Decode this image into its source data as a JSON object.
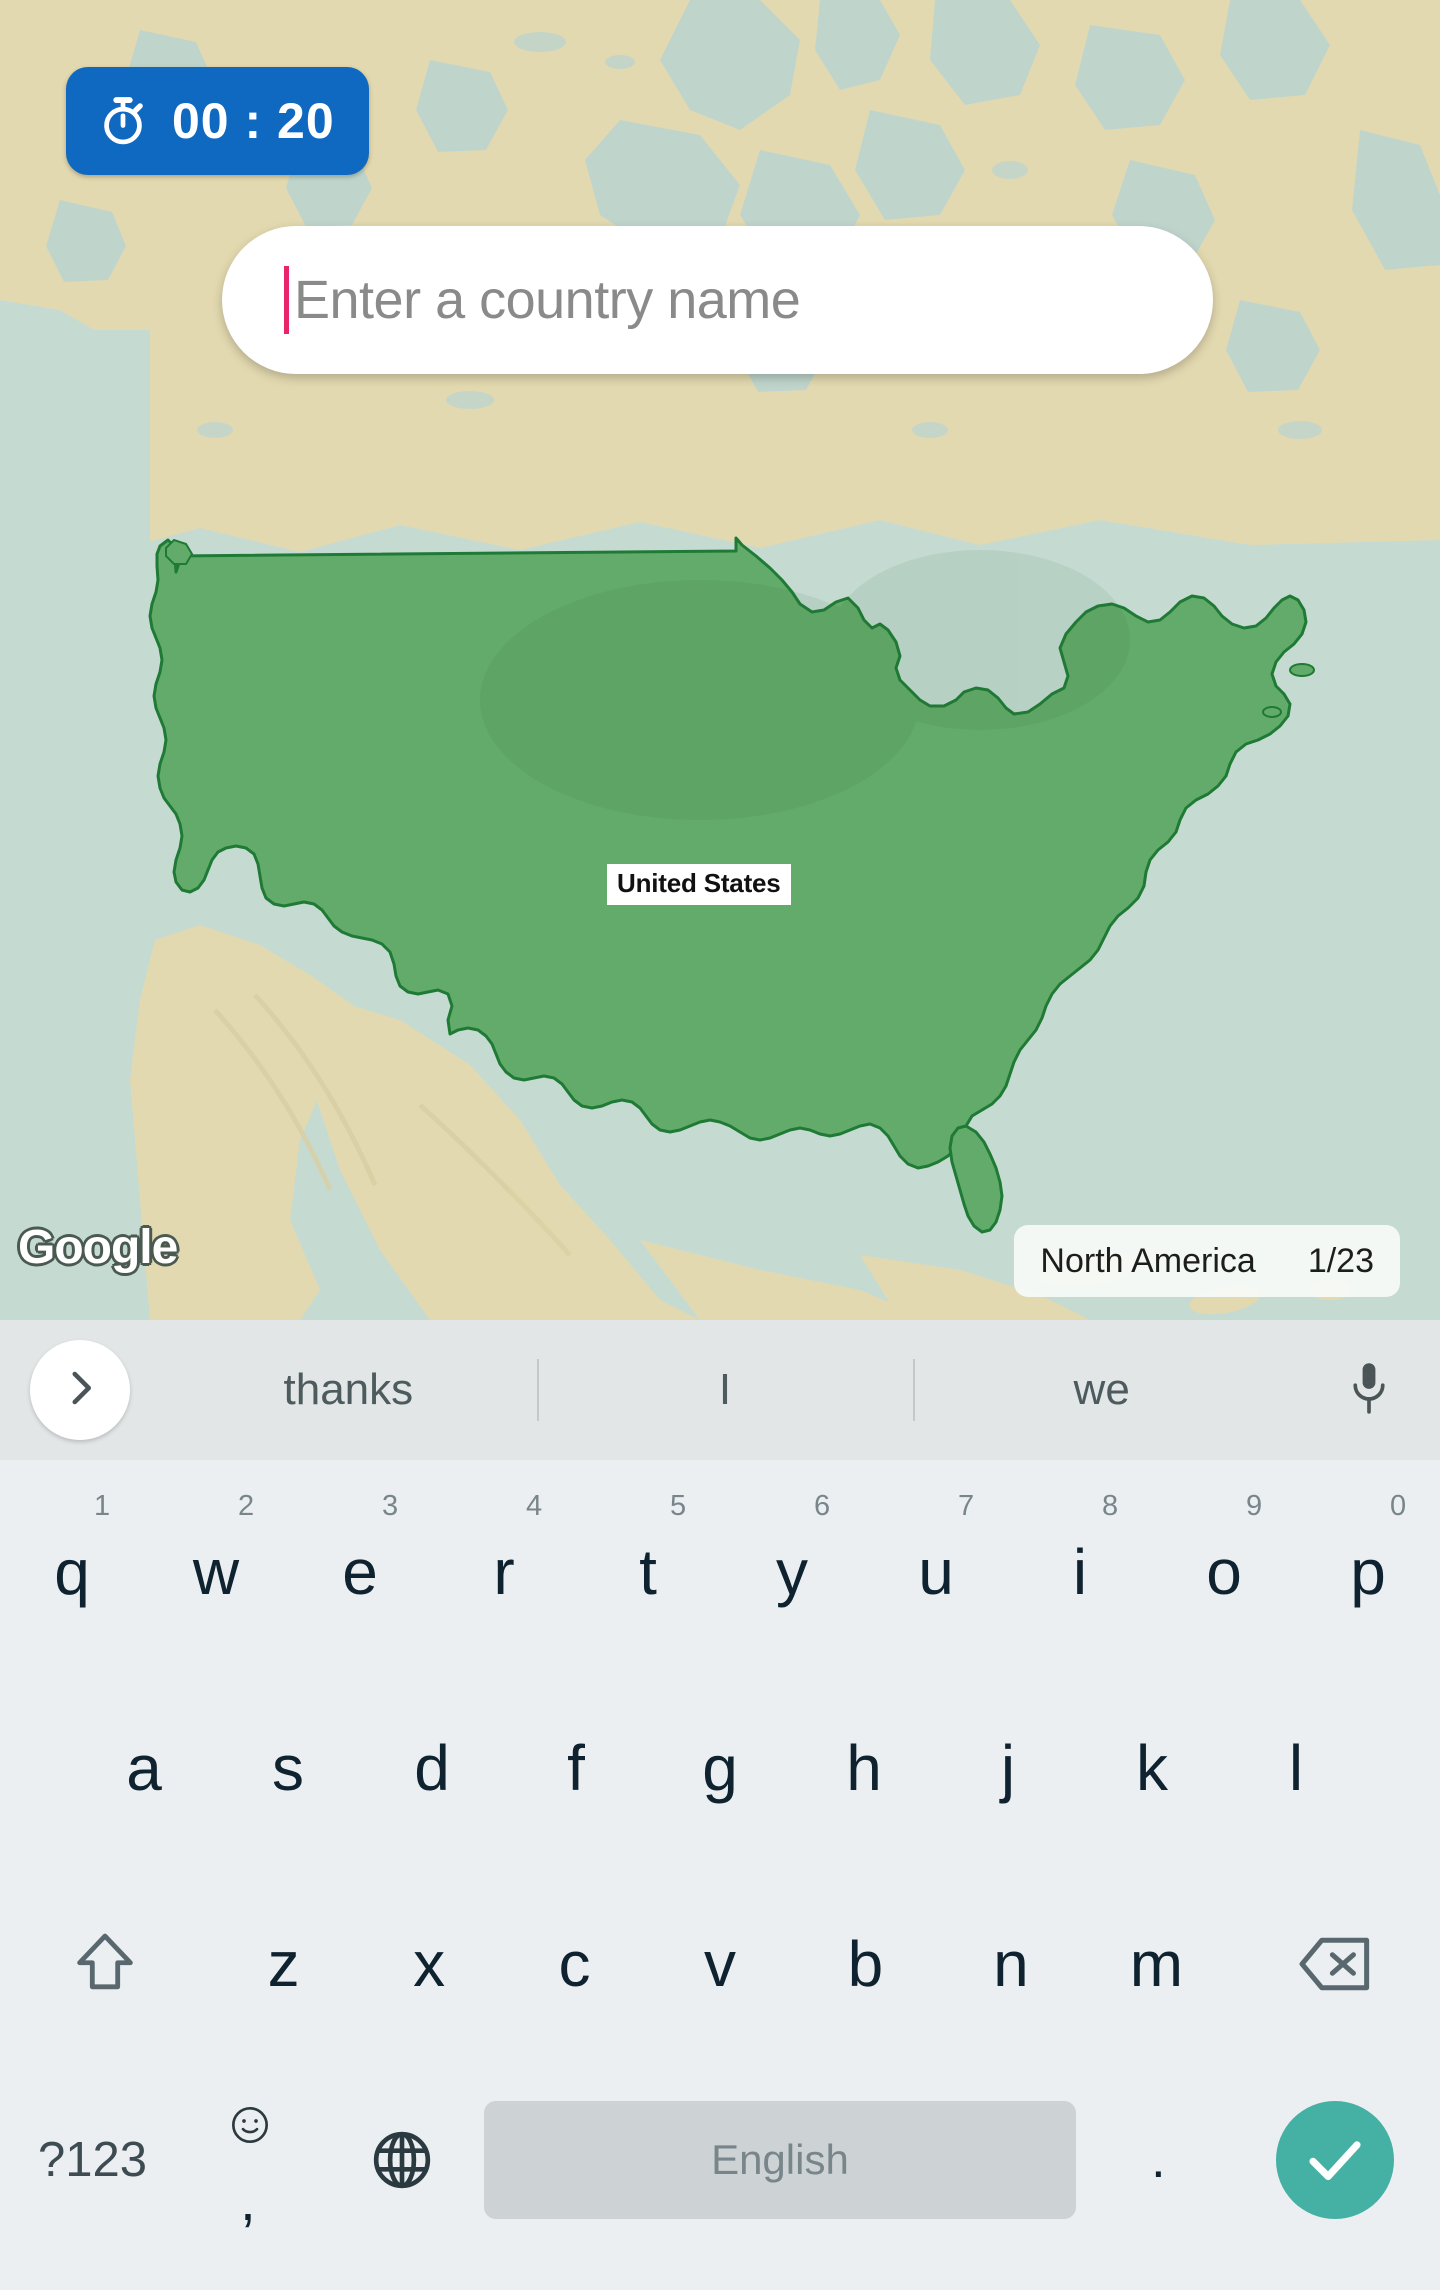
{
  "timer": {
    "icon": "stopwatch-icon",
    "value": "00 : 20",
    "background_color": "#1069c0",
    "text_color": "#ffffff"
  },
  "search": {
    "placeholder": "Enter a country name",
    "value": "",
    "caret_color": "#e8246b"
  },
  "map": {
    "country_label": "United States",
    "highlight_color": "#63ab6a",
    "highlight_outline": "#1f6b2e",
    "land_color": "#e3d9b0",
    "water_color": "#c5dbd2",
    "attribution": "Google"
  },
  "status": {
    "region": "North America",
    "progress": "1/23"
  },
  "keyboard": {
    "suggestion_bar": {
      "expand_icon": "chevron-right-icon",
      "suggestions": [
        "thanks",
        "I",
        "we"
      ],
      "mic_icon": "microphone-icon"
    },
    "row1": [
      {
        "key": "q",
        "num": "1"
      },
      {
        "key": "w",
        "num": "2"
      },
      {
        "key": "e",
        "num": "3"
      },
      {
        "key": "r",
        "num": "4"
      },
      {
        "key": "t",
        "num": "5"
      },
      {
        "key": "y",
        "num": "6"
      },
      {
        "key": "u",
        "num": "7"
      },
      {
        "key": "i",
        "num": "8"
      },
      {
        "key": "o",
        "num": "9"
      },
      {
        "key": "p",
        "num": "0"
      }
    ],
    "row2": [
      "a",
      "s",
      "d",
      "f",
      "g",
      "h",
      "j",
      "k",
      "l"
    ],
    "row3": {
      "shift_icon": "shift-icon",
      "keys": [
        "z",
        "x",
        "c",
        "v",
        "b",
        "n",
        "m"
      ],
      "backspace_icon": "backspace-icon"
    },
    "row4": {
      "symbols_label": "?123",
      "emoji_icon": "emoji-icon",
      "comma_label": ",",
      "globe_icon": "globe-icon",
      "space_label": "English",
      "period_label": ".",
      "enter_icon": "check-icon",
      "enter_color": "#45b0a4"
    }
  }
}
